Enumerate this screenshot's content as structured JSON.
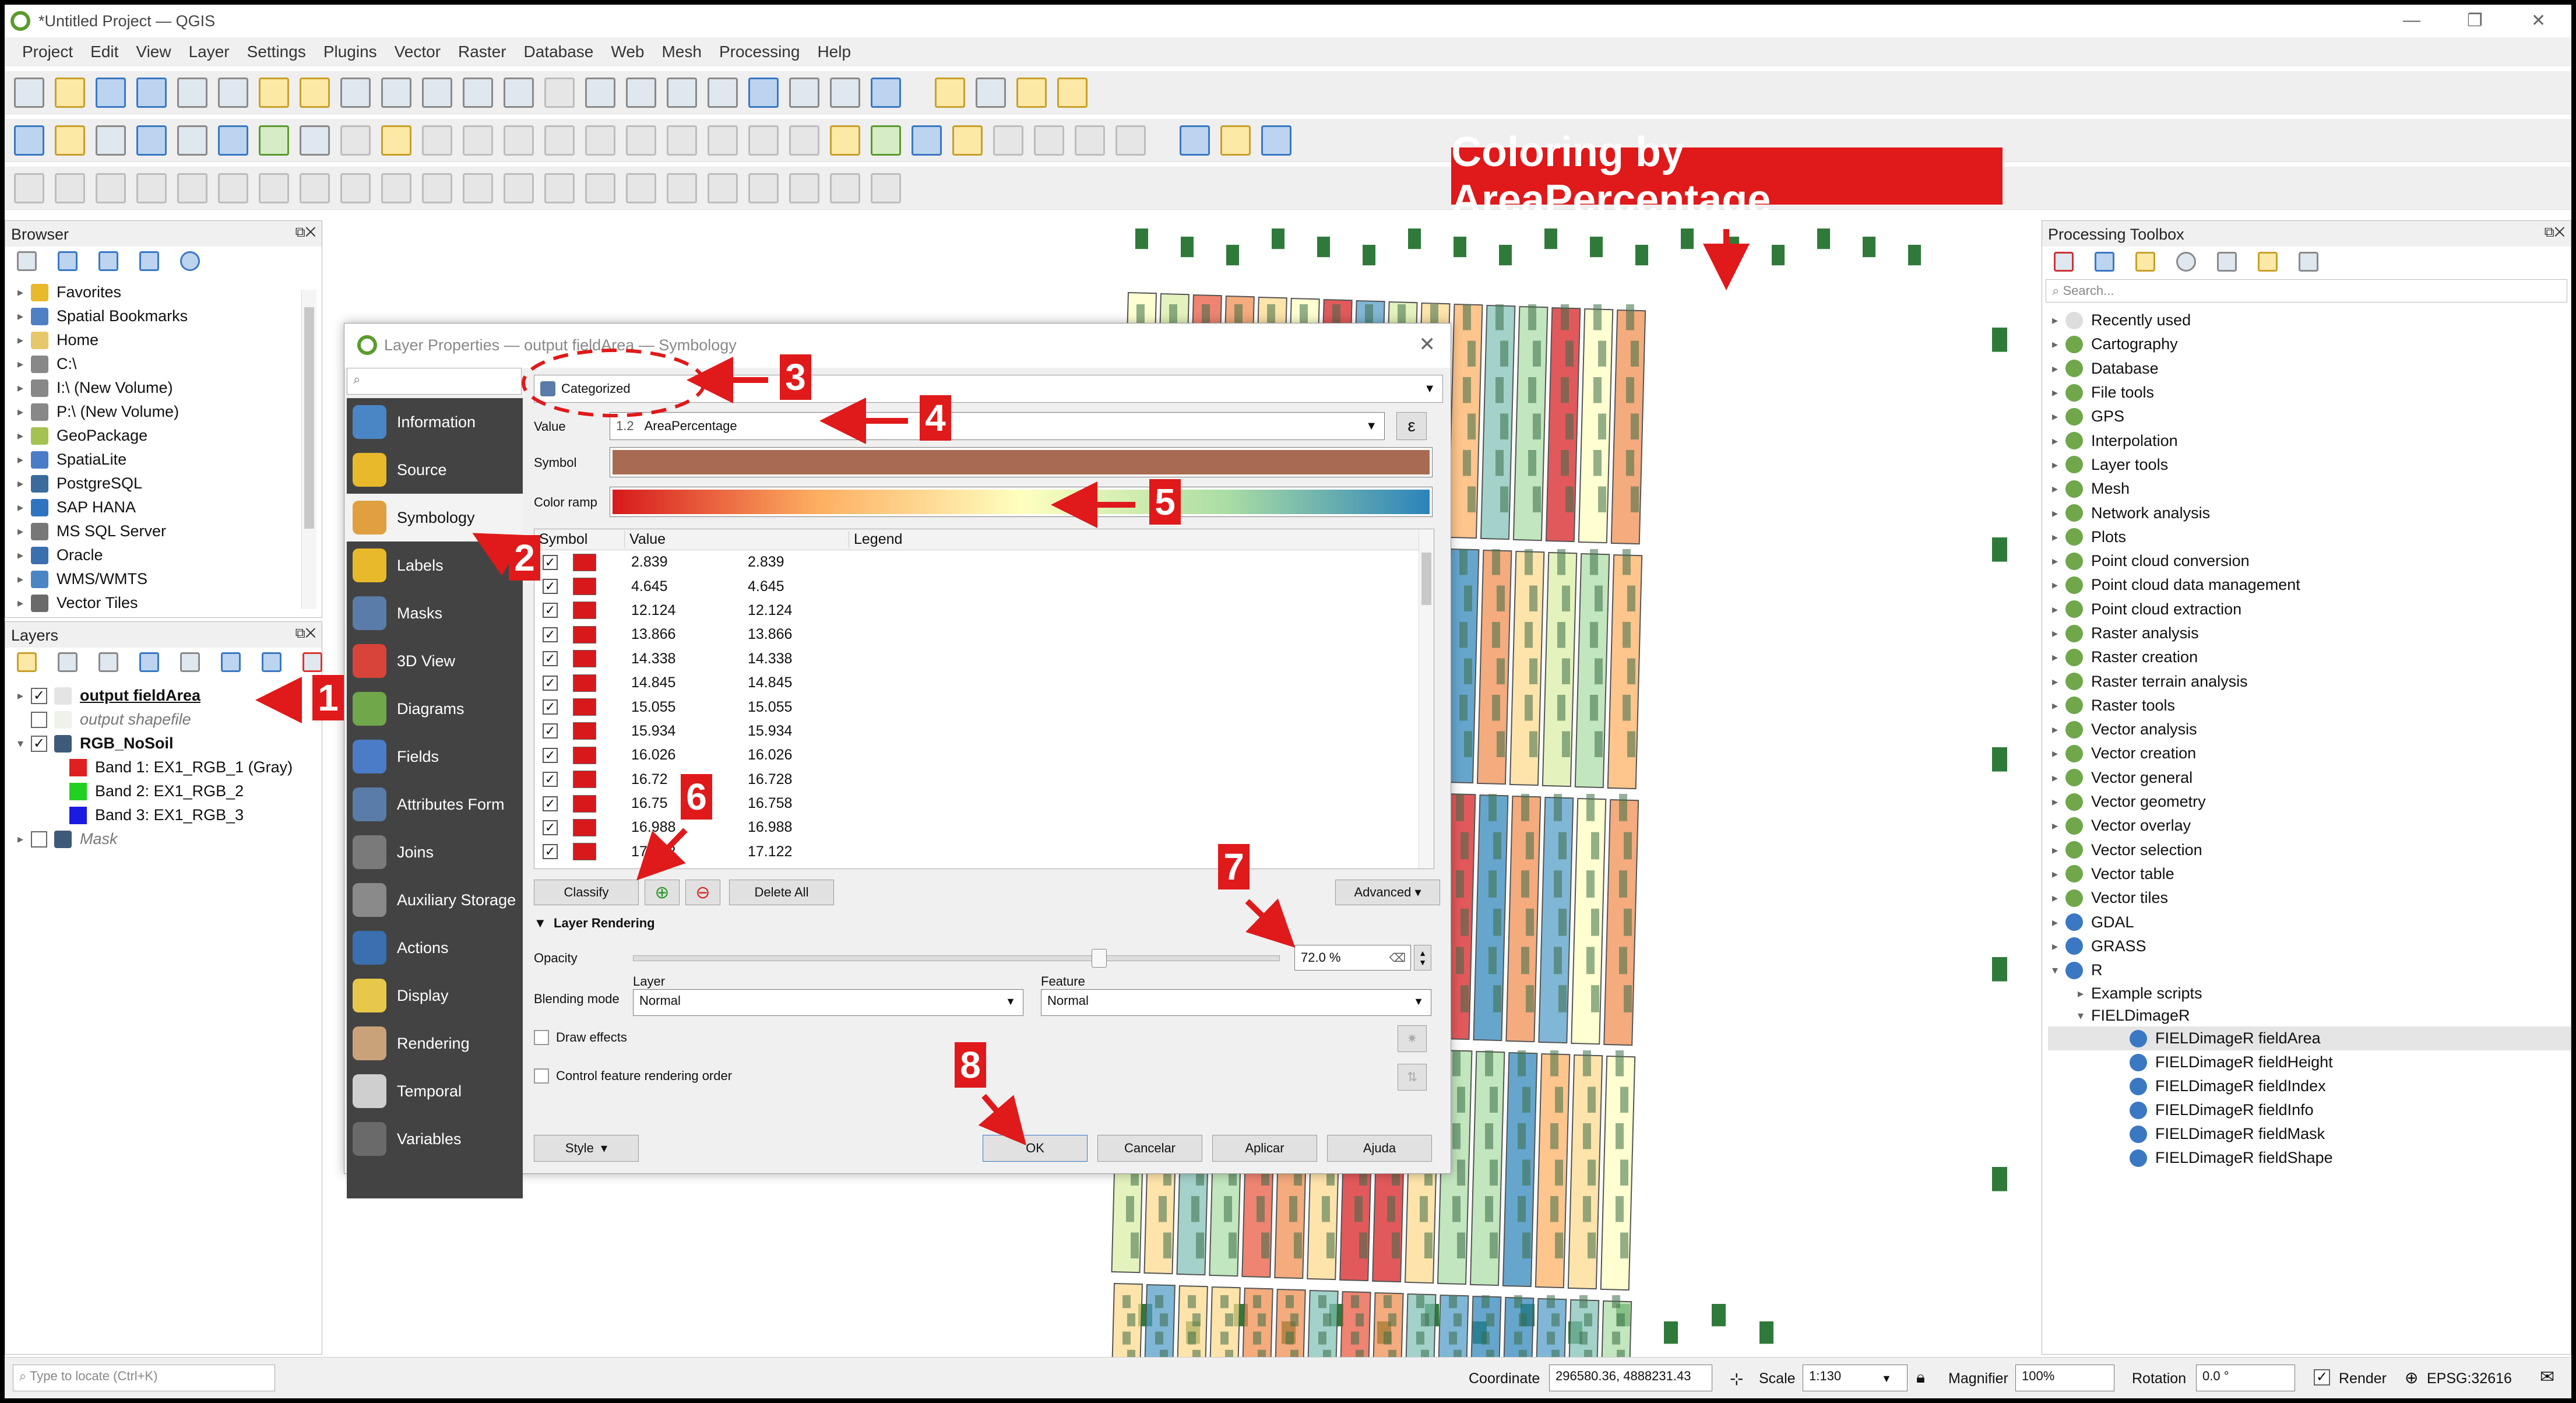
{
  "window": {
    "title": "*Untitled Project — QGIS",
    "controls": [
      "—",
      "❐",
      "✕"
    ]
  },
  "menu": [
    "Project",
    "Edit",
    "View",
    "Layer",
    "Settings",
    "Plugins",
    "Vector",
    "Raster",
    "Database",
    "Web",
    "Mesh",
    "Processing",
    "Help"
  ],
  "browser": {
    "title": "Browser",
    "items": [
      {
        "label": "Favorites",
        "icon": "star-icon",
        "color": "#e8b92b"
      },
      {
        "label": "Spatial Bookmarks",
        "icon": "bookmark-icon",
        "color": "#4f7fc4"
      },
      {
        "label": "Home",
        "icon": "folder-icon",
        "color": "#e6c86b"
      },
      {
        "label": "C:\\",
        "icon": "drive-icon",
        "color": "#888888"
      },
      {
        "label": "I:\\ (New Volume)",
        "icon": "drive-icon",
        "color": "#888888"
      },
      {
        "label": "P:\\ (New Volume)",
        "icon": "drive-icon",
        "color": "#888888"
      },
      {
        "label": "GeoPackage",
        "icon": "geopackage-icon",
        "color": "#a4c24f"
      },
      {
        "label": "SpatiaLite",
        "icon": "spatialite-icon",
        "color": "#4a7cc7"
      },
      {
        "label": "PostgreSQL",
        "icon": "postgresql-icon",
        "color": "#3b6a9c"
      },
      {
        "label": "SAP HANA",
        "icon": "sap-hana-icon",
        "color": "#2f74c0"
      },
      {
        "label": "MS SQL Server",
        "icon": "mssql-icon",
        "color": "#777777"
      },
      {
        "label": "Oracle",
        "icon": "oracle-icon",
        "color": "#3a6fb0"
      },
      {
        "label": "WMS/WMTS",
        "icon": "globe-icon",
        "color": "#4a86c5"
      },
      {
        "label": "Vector Tiles",
        "icon": "vector-tiles-icon",
        "color": "#6a6a6a"
      }
    ]
  },
  "layers": {
    "title": "Layers",
    "items": [
      {
        "label": "output fieldArea",
        "checked": "✓",
        "bold": true
      },
      {
        "label": "output shapefile",
        "checked": "",
        "italic": true
      },
      {
        "label": "RGB_NoSoil",
        "checked": "✓",
        "bold": true
      },
      {
        "label": "Band 1: EX1_RGB_1 (Gray)",
        "swatch": "#e02020"
      },
      {
        "label": "Band 2: EX1_RGB_2",
        "swatch": "#22d022"
      },
      {
        "label": "Band 3: EX1_RGB_3",
        "swatch": "#1a1ae0"
      },
      {
        "label": "Mask",
        "checked": "",
        "italic": true
      }
    ]
  },
  "banner": "Coloring by AreaPercentage",
  "dialog": {
    "title": "Layer Properties — output fieldArea — Symbology",
    "sidebar": [
      "Information",
      "Source",
      "Symbology",
      "Labels",
      "Masks",
      "3D View",
      "Diagrams",
      "Fields",
      "Attributes Form",
      "Joins",
      "Auxiliary Storage",
      "Actions",
      "Display",
      "Rendering",
      "Temporal",
      "Variables"
    ],
    "renderer": "Categorized",
    "value_label": "Value",
    "value_prefix": "1.2",
    "value": "AreaPercentage",
    "symbol_label": "Symbol",
    "color_ramp_label": "Color ramp",
    "table_headers": [
      "Symbol",
      "Value",
      "Legend"
    ],
    "rows": [
      {
        "value": "2.839",
        "legend": "2.839"
      },
      {
        "value": "4.645",
        "legend": "4.645"
      },
      {
        "value": "12.124",
        "legend": "12.124"
      },
      {
        "value": "13.866",
        "legend": "13.866"
      },
      {
        "value": "14.338",
        "legend": "14.338"
      },
      {
        "value": "14.845",
        "legend": "14.845"
      },
      {
        "value": "15.055",
        "legend": "15.055"
      },
      {
        "value": "15.934",
        "legend": "15.934"
      },
      {
        "value": "16.026",
        "legend": "16.026"
      },
      {
        "value": "16.72",
        "legend": "16.728"
      },
      {
        "value": "16.75",
        "legend": "16.758"
      },
      {
        "value": "16.988",
        "legend": "16.988"
      },
      {
        "value": "17.122",
        "legend": "17.122"
      }
    ],
    "classify": "Classify",
    "delete_all": "Delete All",
    "advanced": "Advanced",
    "layer_rendering": "Layer Rendering",
    "opacity_label": "Opacity",
    "opacity": "72.0 %",
    "opacity_fraction": 0.72,
    "blending_label": "Blending mode",
    "layer_label": "Layer",
    "feature_label": "Feature",
    "layer_blend": "Normal",
    "feature_blend": "Normal",
    "draw_effects": "Draw effects",
    "control_order": "Control feature rendering order",
    "style": "Style",
    "ok": "OK",
    "cancel": "Cancelar",
    "apply": "Aplicar",
    "help": "Ajuda"
  },
  "annotations": [
    "1",
    "2",
    "3",
    "4",
    "5",
    "6",
    "7",
    "8"
  ],
  "toolbox": {
    "title": "Processing Toolbox",
    "search_placeholder": "Search...",
    "items": [
      "Recently used",
      "Cartography",
      "Database",
      "File tools",
      "GPS",
      "Interpolation",
      "Layer tools",
      "Mesh",
      "Network analysis",
      "Plots",
      "Point cloud conversion",
      "Point cloud data management",
      "Point cloud extraction",
      "Raster analysis",
      "Raster creation",
      "Raster terrain analysis",
      "Raster tools",
      "Vector analysis",
      "Vector creation",
      "Vector general",
      "Vector geometry",
      "Vector overlay",
      "Vector selection",
      "Vector table",
      "Vector tiles",
      "GDAL",
      "GRASS",
      "R"
    ],
    "r_children": [
      "Example scripts",
      "FIELDimageR"
    ],
    "fieldimager_items": [
      "FIELDimageR fieldArea",
      "FIELDimageR fieldHeight",
      "FIELDimageR fieldIndex",
      "FIELDimageR fieldInfo",
      "FIELDimageR fieldMask",
      "FIELDimageR fieldShape"
    ]
  },
  "status": {
    "locate_placeholder": "Type to locate (Ctrl+K)",
    "coordinate_label": "Coordinate",
    "coordinate": "296580.36, 4888231.43",
    "scale_label": "Scale",
    "scale": "1:130",
    "magnifier_label": "Magnifier",
    "magnifier": "100%",
    "rotation_label": "Rotation",
    "rotation": "0.0 °",
    "render_label": "Render",
    "crs": "EPSG:32616"
  },
  "colors": {
    "accent": "#e0191a",
    "ramp": [
      "#d7191c",
      "#fdae61",
      "#ffffbf",
      "#abdda4",
      "#2b83ba"
    ]
  }
}
